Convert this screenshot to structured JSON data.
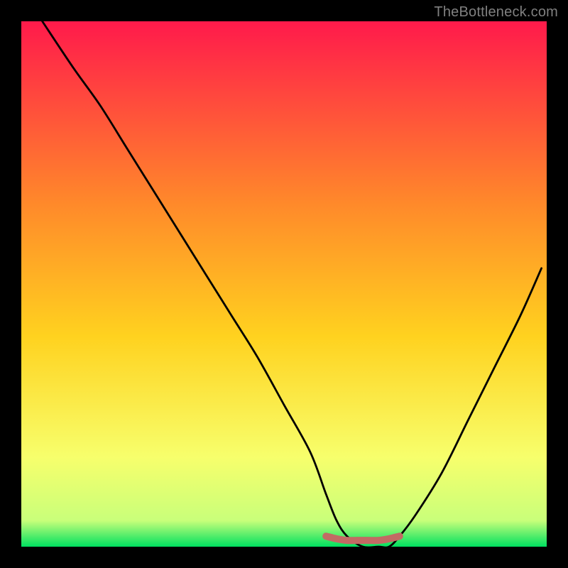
{
  "watermark": "TheBottleneck.com",
  "chart_data": {
    "type": "line",
    "title": "",
    "xlabel": "",
    "ylabel": "",
    "xlim": [
      0,
      100
    ],
    "ylim": [
      0,
      100
    ],
    "series": [
      {
        "name": "bottleneck-curve",
        "x": [
          4,
          10,
          15,
          20,
          25,
          30,
          35,
          40,
          45,
          50,
          55,
          58,
          60,
          62,
          65,
          68,
          70,
          72,
          75,
          80,
          85,
          90,
          95,
          99
        ],
        "y": [
          100,
          91,
          84,
          76,
          68,
          60,
          52,
          44,
          36,
          27,
          18,
          10,
          5,
          2,
          0,
          0,
          0,
          2,
          6,
          14,
          24,
          34,
          44,
          53
        ]
      },
      {
        "name": "optimal-zone-marker",
        "x": [
          58,
          60,
          62,
          64,
          66,
          68,
          70,
          72
        ],
        "y": [
          2,
          1.5,
          1.2,
          1.2,
          1.2,
          1.2,
          1.5,
          2
        ]
      }
    ],
    "note": "Axis values are percentage estimates read from the rendered curve; the image shows no numeric tick labels."
  },
  "colors": {
    "frame": "#000000",
    "curve": "#000000",
    "marker": "#c26a64",
    "gradient_top": "#ff1a4b",
    "gradient_mid1": "#ff6a2a",
    "gradient_mid2": "#ffd21f",
    "gradient_mid3": "#f7ff6c",
    "gradient_bottom": "#00e060"
  }
}
